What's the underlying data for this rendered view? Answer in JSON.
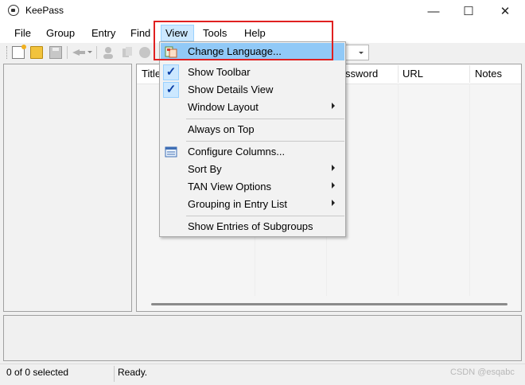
{
  "window": {
    "title": "KeePass",
    "minimize": "—",
    "maximize": "☐",
    "close": "✕"
  },
  "menubar": {
    "items": [
      "File",
      "Group",
      "Entry",
      "Find",
      "View",
      "Tools",
      "Help"
    ]
  },
  "list": {
    "columns": [
      "Title",
      "ssword",
      "URL",
      "Notes"
    ]
  },
  "view_menu": {
    "change_language": "Change Language...",
    "show_toolbar": "Show Toolbar",
    "show_details_view": "Show Details View",
    "window_layout": "Window Layout",
    "always_on_top": "Always on Top",
    "configure_columns": "Configure Columns...",
    "sort_by": "Sort By",
    "tan_view_options": "TAN View Options",
    "grouping_in_entry_list": "Grouping in Entry List",
    "show_entries_of_subgroups": "Show Entries of Subgroups",
    "checked": {
      "show_toolbar": true,
      "show_details_view": true
    },
    "check_glyph": "✓"
  },
  "status": {
    "selection": "0 of 0 selected",
    "message": "Ready."
  },
  "watermark": "CSDN @esqabc",
  "colors": {
    "highlight": "#91c9f7",
    "annotation": "#e02020",
    "menu_hover": "#cce8ff"
  },
  "icons": [
    "new-database-icon",
    "open-database-icon",
    "save-icon",
    "add-entry-icon",
    "search-icon",
    "change-language-icon",
    "configure-columns-icon"
  ]
}
